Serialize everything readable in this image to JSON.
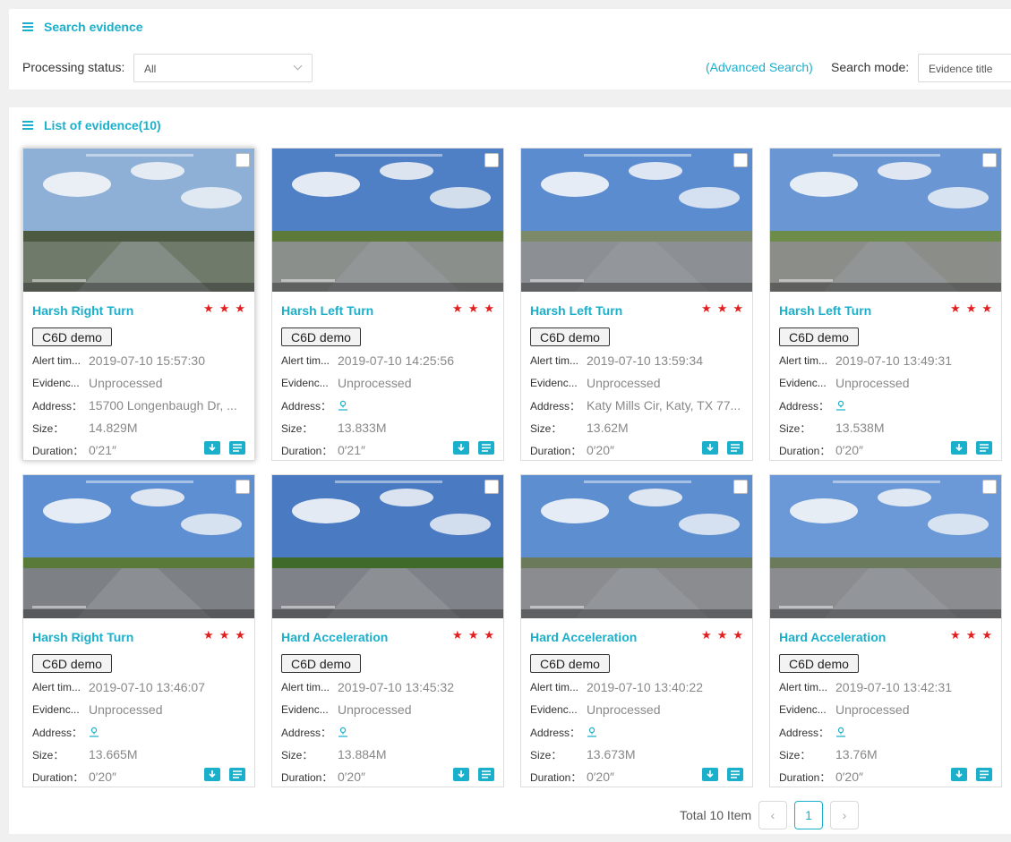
{
  "search": {
    "title": "Search evidence",
    "processing_label": "Processing status:",
    "processing_value": "All",
    "advanced": "(Advanced Search)",
    "mode_label": "Search mode:",
    "mode_value": "Evidence title"
  },
  "list": {
    "title": "List of evidence(10)"
  },
  "labels": {
    "alert": "Alert tim...",
    "evidence": "Evidenc...",
    "address": "Address：",
    "size": "Size：",
    "duration": "Duration："
  },
  "cards": [
    {
      "title": "Harsh Right Turn",
      "tag": "C6D demo",
      "alert_time": "2019-07-10 15:57:30",
      "status": "Unprocessed",
      "address": "15700 Longenbaugh Dr, ...",
      "size": "14.829M",
      "duration": "0′21″",
      "rating": 3
    },
    {
      "title": "Harsh Left Turn",
      "tag": "C6D demo",
      "alert_time": "2019-07-10 14:25:56",
      "status": "Unprocessed",
      "address": "",
      "size": "13.833M",
      "duration": "0′21″",
      "rating": 3
    },
    {
      "title": "Harsh Left Turn",
      "tag": "C6D demo",
      "alert_time": "2019-07-10 13:59:34",
      "status": "Unprocessed",
      "address": "Katy Mills Cir, Katy, TX 77...",
      "size": "13.62M",
      "duration": "0′20″",
      "rating": 3
    },
    {
      "title": "Harsh Left Turn",
      "tag": "C6D demo",
      "alert_time": "2019-07-10 13:49:31",
      "status": "Unprocessed",
      "address": "",
      "size": "13.538M",
      "duration": "0′20″",
      "rating": 3
    },
    {
      "title": "Harsh Right Turn",
      "tag": "C6D demo",
      "alert_time": "2019-07-10 13:46:07",
      "status": "Unprocessed",
      "address": "",
      "size": "13.665M",
      "duration": "0′20″",
      "rating": 3
    },
    {
      "title": "Hard Acceleration",
      "tag": "C6D demo",
      "alert_time": "2019-07-10 13:45:32",
      "status": "Unprocessed",
      "address": "",
      "size": "13.884M",
      "duration": "0′20″",
      "rating": 3
    },
    {
      "title": "Hard Acceleration",
      "tag": "C6D demo",
      "alert_time": "2019-07-10 13:40:22",
      "status": "Unprocessed",
      "address": "",
      "size": "13.673M",
      "duration": "0′20″",
      "rating": 3
    },
    {
      "title": "Hard Acceleration",
      "tag": "C6D demo",
      "alert_time": "2019-07-10 13:42:31",
      "status": "Unprocessed",
      "address": "",
      "size": "13.76M",
      "duration": "0′20″",
      "rating": 3
    }
  ],
  "pagination": {
    "total": "Total 10 Item",
    "prev": "‹",
    "current": "1",
    "next": "›"
  },
  "colors": {
    "accent": "#1ab0cc",
    "star": "#e02020"
  }
}
